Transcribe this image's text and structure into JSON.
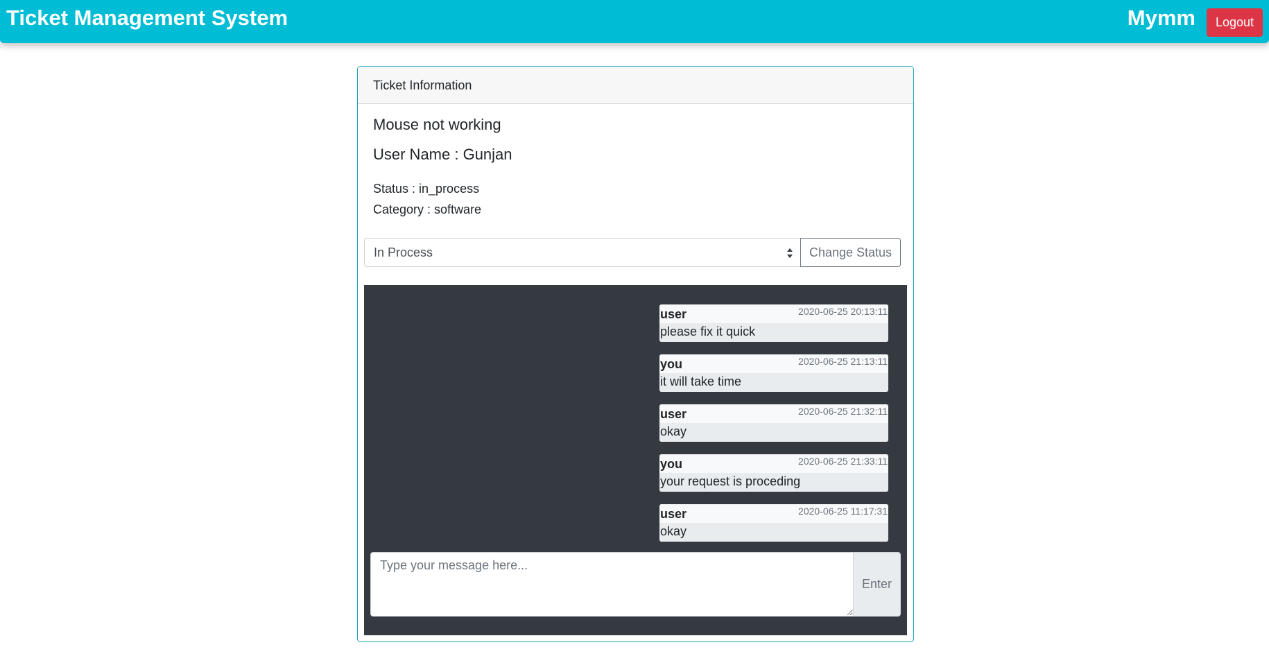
{
  "navbar": {
    "brand": "Ticket Management System",
    "user": "Mymm",
    "logout_label": "Logout"
  },
  "card": {
    "header": "Ticket Information",
    "title": "Mouse not working",
    "user_name": "User Name : Gunjan",
    "status": "Status : in_process",
    "category": "Category : software"
  },
  "status_control": {
    "selected": "In Process",
    "button_label": "Change Status"
  },
  "messages": [
    {
      "sender": "user",
      "time": "2020-06-25 20:13:11",
      "text": "please fix it quick"
    },
    {
      "sender": "you",
      "time": "2020-06-25 21:13:11",
      "text": "it will take time"
    },
    {
      "sender": "user",
      "time": "2020-06-25 21:32:11",
      "text": "okay"
    },
    {
      "sender": "you",
      "time": "2020-06-25 21:33:11",
      "text": "your request is proceding"
    },
    {
      "sender": "user",
      "time": "2020-06-25 11:17:31",
      "text": "okay"
    }
  ],
  "chat_input": {
    "placeholder": "Type your message here...",
    "value": "",
    "button_label": "Enter"
  },
  "colors": {
    "navbar": "#00bcd4",
    "danger": "#dc3545",
    "card_border": "#17a2b8",
    "chat_background": "#343a40"
  }
}
